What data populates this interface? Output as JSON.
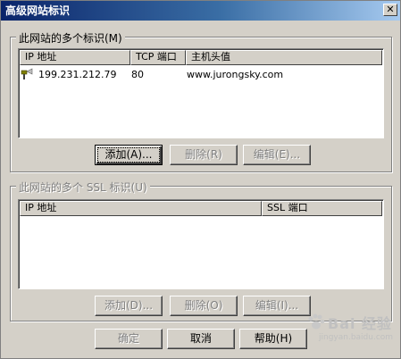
{
  "window": {
    "title": "高级网站标识",
    "close_glyph": "✕"
  },
  "group1": {
    "label": "此网站的多个标识(M)",
    "columns": [
      "IP 地址",
      "TCP 端口",
      "主机头值"
    ],
    "rows": [
      {
        "ip": "199.231.212.79",
        "port": "80",
        "host": "www.jurongsky.com"
      }
    ],
    "buttons": {
      "add": "添加(A)...",
      "remove": "删除(R)",
      "edit": "编辑(E)..."
    }
  },
  "group2": {
    "label": "此网站的多个 SSL 标识(U)",
    "columns": [
      "IP 地址",
      "SSL 端口"
    ],
    "buttons": {
      "add": "添加(D)...",
      "remove": "删除(O)",
      "edit": "编辑(I)..."
    }
  },
  "footer": {
    "ok": "确定",
    "cancel": "取消",
    "help": "帮助(H)"
  },
  "watermark": {
    "text": "Bai 经验",
    "sub": "jingyan.baidu.com"
  },
  "icons": {
    "row_icon": "site-binding-icon",
    "close": "close-icon"
  }
}
